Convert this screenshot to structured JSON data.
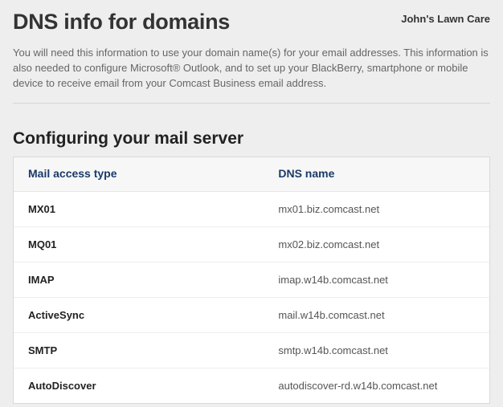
{
  "header": {
    "title": "DNS info for domains",
    "account": "John's Lawn Care"
  },
  "intro": "You will need this information to use your domain name(s) for your email addresses. This information is also needed to configure Microsoft® Outlook, and to set up your BlackBerry, smartphone or mobile device to receive email from your Comcast Business email address.",
  "section_title": "Configuring your mail server",
  "table": {
    "headers": {
      "access_type": "Mail access type",
      "dns_name": "DNS name"
    },
    "rows": [
      {
        "type": "MX01",
        "dns": "mx01.biz.comcast.net"
      },
      {
        "type": "MQ01",
        "dns": "mx02.biz.comcast.net"
      },
      {
        "type": "IMAP",
        "dns": "imap.w14b.comcast.net"
      },
      {
        "type": "ActiveSync",
        "dns": "mail.w14b.comcast.net"
      },
      {
        "type": "SMTP",
        "dns": "smtp.w14b.comcast.net"
      },
      {
        "type": "AutoDiscover",
        "dns": "autodiscover-rd.w14b.comcast.net"
      }
    ]
  }
}
